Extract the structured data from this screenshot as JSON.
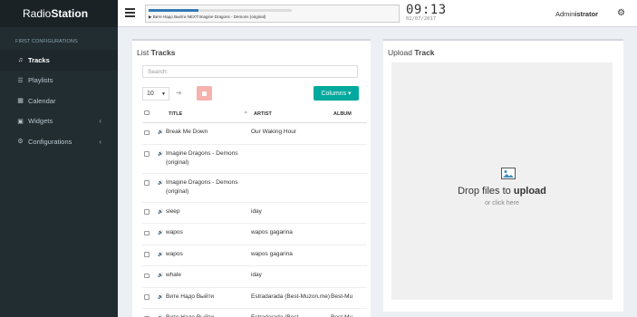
{
  "brand": {
    "prefix": "Radio",
    "suffix": "Station"
  },
  "sidebar": {
    "header": "FIRST CONFIGURATIONS",
    "items": [
      {
        "label": "Tracks",
        "icon": "music-icon",
        "glyph": "♫",
        "active": true
      },
      {
        "label": "Playlists",
        "icon": "list-icon",
        "glyph": "☰",
        "active": false
      },
      {
        "label": "Calendar",
        "icon": "calendar-icon",
        "glyph": "▦",
        "active": false
      },
      {
        "label": "Widgets",
        "icon": "widgets-icon",
        "glyph": "▣",
        "active": false,
        "chevron": "‹"
      },
      {
        "label": "Configurations",
        "icon": "cogs-icon",
        "glyph": "⚙",
        "active": false,
        "chevron": "‹"
      }
    ]
  },
  "topbar": {
    "now_playing": "▶ Витe Надо Выйти NEXT:Imagine Dragons - Demons (original)",
    "progress": 0.35,
    "time": "09:13",
    "date": "02/07/2017",
    "user_prefix": "Admin",
    "user_suffix": "istrator"
  },
  "list": {
    "title_prefix": "List ",
    "title_suffix": "Tracks",
    "search_placeholder": "Search:",
    "per_page": "10",
    "columns_button": "Columns ▾",
    "headers": {
      "title": "TITLE",
      "sort": "^",
      "artist": "ARTIST",
      "album": "ALBUM"
    },
    "rows": [
      {
        "title": "Break Me Down",
        "artist": "Our Waking Hour",
        "album": ""
      },
      {
        "title": "Imagine Dragons - Demons (original)",
        "artist": "",
        "album": ""
      },
      {
        "title": "Imagine Dragons - Demons (original)",
        "artist": "",
        "album": ""
      },
      {
        "title": "sleep",
        "artist": "iday",
        "album": ""
      },
      {
        "title": "wapos",
        "artist": "wapos gagarina",
        "album": ""
      },
      {
        "title": "wapos",
        "artist": "wapos gagarina",
        "album": ""
      },
      {
        "title": "whale",
        "artist": "iday",
        "album": ""
      },
      {
        "title": "Вите Надо Выйти",
        "artist": "Estradarada (Best-Muzon.me)",
        "album": "Best-Mu"
      },
      {
        "title": "Вите Надо Выйти",
        "artist": "Estradarada (Best-",
        "album": "Best-Mu"
      }
    ]
  },
  "upload": {
    "title_prefix": "Upload ",
    "title_suffix": "Track",
    "drop_prefix": "Drop files to ",
    "drop_suffix": "upload",
    "or_click": "or click here"
  }
}
